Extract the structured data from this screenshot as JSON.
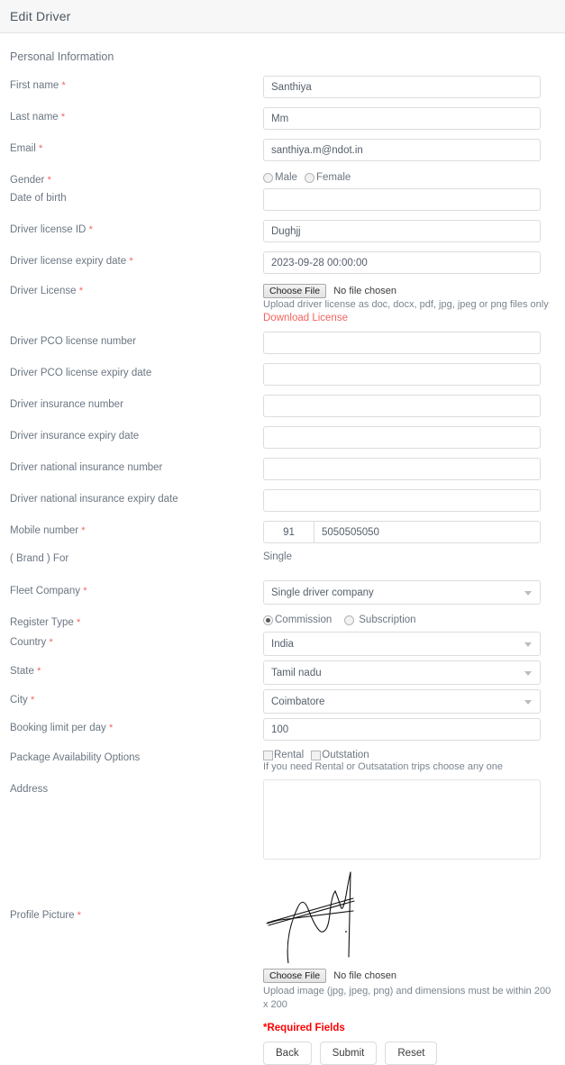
{
  "header": {
    "title": "Edit Driver"
  },
  "section": {
    "personal_information": "Personal Information"
  },
  "fields": {
    "first_name": {
      "label": "First name",
      "value": "Santhiya"
    },
    "last_name": {
      "label": "Last name",
      "value": "Mm"
    },
    "email": {
      "label": "Email",
      "value": "santhiya.m@ndot.in"
    },
    "gender": {
      "label": "Gender",
      "male": "Male",
      "female": "Female",
      "selected": ""
    },
    "date_of_birth": {
      "label": "Date of birth",
      "value": ""
    },
    "driver_license_id": {
      "label": "Driver license ID",
      "value": "Dughjj"
    },
    "driver_license_expiry_date": {
      "label": "Driver license expiry date",
      "value": "2023-09-28 00:00:00"
    },
    "driver_license": {
      "label": "Driver License",
      "choose_file": "Choose File",
      "file_status": "No file chosen",
      "hint": "Upload driver license as doc, docx, pdf, jpg, jpeg or png files only",
      "download_link": "Download License"
    },
    "driver_pco_license_number": {
      "label": "Driver PCO license number",
      "value": ""
    },
    "driver_pco_license_expiry_date": {
      "label": "Driver PCO license expiry date",
      "value": ""
    },
    "driver_insurance_number": {
      "label": "Driver insurance number",
      "value": ""
    },
    "driver_insurance_expiry_date": {
      "label": "Driver insurance expiry date",
      "value": ""
    },
    "driver_national_insurance_number": {
      "label": "Driver national insurance number",
      "value": ""
    },
    "driver_national_insurance_expiry_date": {
      "label": "Driver national insurance expiry date",
      "value": ""
    },
    "mobile_number": {
      "label": "Mobile number",
      "country_code": "91",
      "value": "5050505050"
    },
    "brand_for": {
      "label": "( Brand ) For",
      "value": "Single"
    },
    "fleet_company": {
      "label": "Fleet Company",
      "value": "Single driver company"
    },
    "register_type": {
      "label": "Register Type",
      "commission": "Commission",
      "subscription": "Subscription",
      "selected": "Commission"
    },
    "country": {
      "label": "Country",
      "value": "India"
    },
    "state": {
      "label": "State",
      "value": "Tamil nadu"
    },
    "city": {
      "label": "City",
      "value": "Coimbatore"
    },
    "booking_limit_per_day": {
      "label": "Booking limit per day",
      "value": "100"
    },
    "package_availability_options": {
      "label": "Package Availability Options",
      "rental": "Rental",
      "outstation": "Outstation",
      "rental_checked": false,
      "outstation_checked": false,
      "hint": "If you need Rental or Outsatation trips choose any one"
    },
    "address": {
      "label": "Address",
      "value": ""
    },
    "profile_picture": {
      "label": "Profile Picture",
      "choose_file": "Choose File",
      "file_status": "No file chosen",
      "hint": "Upload image (jpg, jpeg, png) and dimensions must be within 200 x 200"
    }
  },
  "footer": {
    "required_note": "*Required Fields",
    "back": "Back",
    "submit": "Submit",
    "reset": "Reset"
  },
  "colors": {
    "required_star": "#f4645f",
    "link": "#f4645f",
    "required_note": "#ff0000",
    "header_bg": "#f7f7f7",
    "label_text": "#6b7682"
  }
}
